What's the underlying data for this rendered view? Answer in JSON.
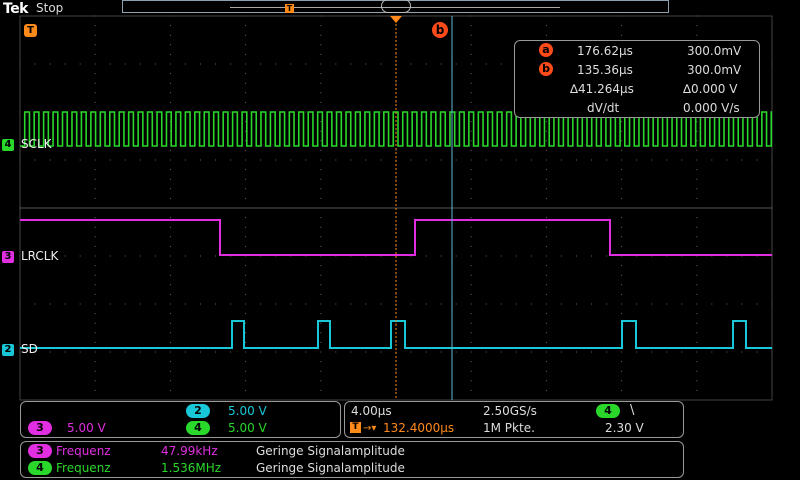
{
  "header": {
    "brand": "Tek",
    "status": "Stop"
  },
  "markers": {
    "trigger_marker": "T",
    "cursor_a": "a",
    "cursor_b": "b"
  },
  "measurements": {
    "a_time": "176.62µs",
    "a_volt": "300.0mV",
    "b_time": "135.36µs",
    "b_volt": "300.0mV",
    "delta_time": "∆41.264µs",
    "delta_volt": "∆0.000 V",
    "dvdt_label": "dV/dt",
    "dvdt_value": "0.000 V/s"
  },
  "channels": [
    {
      "number": "4",
      "name": "SCLK",
      "color": "#29d82a"
    },
    {
      "number": "3",
      "name": "LRCLK",
      "color": "#e02ee0"
    },
    {
      "number": "2",
      "name": "SD",
      "color": "#18c8d8"
    }
  ],
  "vertical": {
    "ch2_scale": "5.00 V",
    "ch3_scale": "5.00 V",
    "ch4_scale": "5.00 V"
  },
  "horizontal": {
    "time_div": "4.00µs",
    "sample_rate": "2.50GS/s",
    "trigger_pos": "132.4000µs",
    "record_length": "1M Pkte.",
    "trigger_channel": "4",
    "trigger_slope": "\\",
    "trigger_level": "2.30 V"
  },
  "freq_measurements": [
    {
      "channel": "3",
      "label": "Frequenz",
      "value": "47.99kHz",
      "note": "Geringe Signalamplitude"
    },
    {
      "channel": "4",
      "label": "Frequenz",
      "value": "1.536MHz",
      "note": "Geringe Signalamplitude"
    }
  ],
  "colors": {
    "ch2": "#18c8d8",
    "ch3": "#e02ee0",
    "ch4": "#29d82a",
    "trigger": "#ff8a1a",
    "cursor": "#ff4a1a",
    "grid": "#555"
  }
}
